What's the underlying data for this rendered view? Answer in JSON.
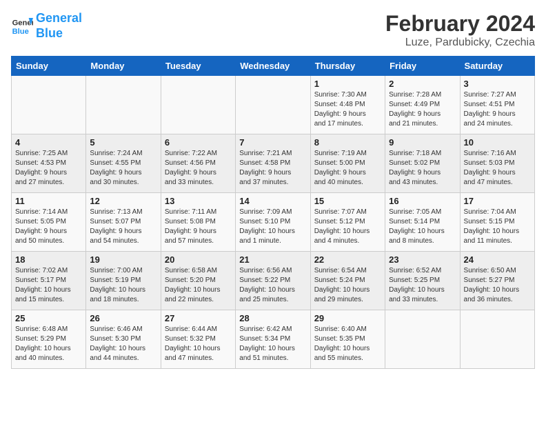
{
  "header": {
    "logo_line1": "General",
    "logo_line2": "Blue",
    "month_year": "February 2024",
    "location": "Luze, Pardubicky, Czechia"
  },
  "weekdays": [
    "Sunday",
    "Monday",
    "Tuesday",
    "Wednesday",
    "Thursday",
    "Friday",
    "Saturday"
  ],
  "weeks": [
    [
      {
        "day": "",
        "info": ""
      },
      {
        "day": "",
        "info": ""
      },
      {
        "day": "",
        "info": ""
      },
      {
        "day": "",
        "info": ""
      },
      {
        "day": "1",
        "info": "Sunrise: 7:30 AM\nSunset: 4:48 PM\nDaylight: 9 hours\nand 17 minutes."
      },
      {
        "day": "2",
        "info": "Sunrise: 7:28 AM\nSunset: 4:49 PM\nDaylight: 9 hours\nand 21 minutes."
      },
      {
        "day": "3",
        "info": "Sunrise: 7:27 AM\nSunset: 4:51 PM\nDaylight: 9 hours\nand 24 minutes."
      }
    ],
    [
      {
        "day": "4",
        "info": "Sunrise: 7:25 AM\nSunset: 4:53 PM\nDaylight: 9 hours\nand 27 minutes."
      },
      {
        "day": "5",
        "info": "Sunrise: 7:24 AM\nSunset: 4:55 PM\nDaylight: 9 hours\nand 30 minutes."
      },
      {
        "day": "6",
        "info": "Sunrise: 7:22 AM\nSunset: 4:56 PM\nDaylight: 9 hours\nand 33 minutes."
      },
      {
        "day": "7",
        "info": "Sunrise: 7:21 AM\nSunset: 4:58 PM\nDaylight: 9 hours\nand 37 minutes."
      },
      {
        "day": "8",
        "info": "Sunrise: 7:19 AM\nSunset: 5:00 PM\nDaylight: 9 hours\nand 40 minutes."
      },
      {
        "day": "9",
        "info": "Sunrise: 7:18 AM\nSunset: 5:02 PM\nDaylight: 9 hours\nand 43 minutes."
      },
      {
        "day": "10",
        "info": "Sunrise: 7:16 AM\nSunset: 5:03 PM\nDaylight: 9 hours\nand 47 minutes."
      }
    ],
    [
      {
        "day": "11",
        "info": "Sunrise: 7:14 AM\nSunset: 5:05 PM\nDaylight: 9 hours\nand 50 minutes."
      },
      {
        "day": "12",
        "info": "Sunrise: 7:13 AM\nSunset: 5:07 PM\nDaylight: 9 hours\nand 54 minutes."
      },
      {
        "day": "13",
        "info": "Sunrise: 7:11 AM\nSunset: 5:08 PM\nDaylight: 9 hours\nand 57 minutes."
      },
      {
        "day": "14",
        "info": "Sunrise: 7:09 AM\nSunset: 5:10 PM\nDaylight: 10 hours\nand 1 minute."
      },
      {
        "day": "15",
        "info": "Sunrise: 7:07 AM\nSunset: 5:12 PM\nDaylight: 10 hours\nand 4 minutes."
      },
      {
        "day": "16",
        "info": "Sunrise: 7:05 AM\nSunset: 5:14 PM\nDaylight: 10 hours\nand 8 minutes."
      },
      {
        "day": "17",
        "info": "Sunrise: 7:04 AM\nSunset: 5:15 PM\nDaylight: 10 hours\nand 11 minutes."
      }
    ],
    [
      {
        "day": "18",
        "info": "Sunrise: 7:02 AM\nSunset: 5:17 PM\nDaylight: 10 hours\nand 15 minutes."
      },
      {
        "day": "19",
        "info": "Sunrise: 7:00 AM\nSunset: 5:19 PM\nDaylight: 10 hours\nand 18 minutes."
      },
      {
        "day": "20",
        "info": "Sunrise: 6:58 AM\nSunset: 5:20 PM\nDaylight: 10 hours\nand 22 minutes."
      },
      {
        "day": "21",
        "info": "Sunrise: 6:56 AM\nSunset: 5:22 PM\nDaylight: 10 hours\nand 25 minutes."
      },
      {
        "day": "22",
        "info": "Sunrise: 6:54 AM\nSunset: 5:24 PM\nDaylight: 10 hours\nand 29 minutes."
      },
      {
        "day": "23",
        "info": "Sunrise: 6:52 AM\nSunset: 5:25 PM\nDaylight: 10 hours\nand 33 minutes."
      },
      {
        "day": "24",
        "info": "Sunrise: 6:50 AM\nSunset: 5:27 PM\nDaylight: 10 hours\nand 36 minutes."
      }
    ],
    [
      {
        "day": "25",
        "info": "Sunrise: 6:48 AM\nSunset: 5:29 PM\nDaylight: 10 hours\nand 40 minutes."
      },
      {
        "day": "26",
        "info": "Sunrise: 6:46 AM\nSunset: 5:30 PM\nDaylight: 10 hours\nand 44 minutes."
      },
      {
        "day": "27",
        "info": "Sunrise: 6:44 AM\nSunset: 5:32 PM\nDaylight: 10 hours\nand 47 minutes."
      },
      {
        "day": "28",
        "info": "Sunrise: 6:42 AM\nSunset: 5:34 PM\nDaylight: 10 hours\nand 51 minutes."
      },
      {
        "day": "29",
        "info": "Sunrise: 6:40 AM\nSunset: 5:35 PM\nDaylight: 10 hours\nand 55 minutes."
      },
      {
        "day": "",
        "info": ""
      },
      {
        "day": "",
        "info": ""
      }
    ]
  ]
}
